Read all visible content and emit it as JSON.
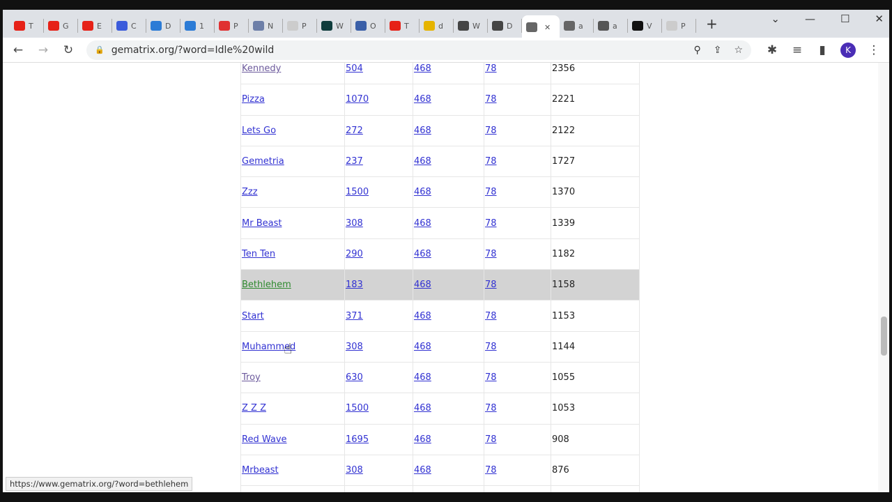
{
  "tabs": [
    {
      "label": "T",
      "color": "#e62117"
    },
    {
      "label": "G",
      "color": "#e62117"
    },
    {
      "label": "E",
      "color": "#e62117"
    },
    {
      "label": "C",
      "color": "#3b5bdb"
    },
    {
      "label": "D",
      "color": "#2b7bd6"
    },
    {
      "label": "1",
      "color": "#2b7bd6"
    },
    {
      "label": "P",
      "color": "#e03131"
    },
    {
      "label": "N",
      "color": "#6d7fa8"
    },
    {
      "label": "P",
      "color": "#cccccc"
    },
    {
      "label": "W",
      "color": "#0f3d3d"
    },
    {
      "label": "O",
      "color": "#3a5fa8"
    },
    {
      "label": "T",
      "color": "#e62117"
    },
    {
      "label": "d",
      "color": "#e6b400"
    },
    {
      "label": "W",
      "color": "#444444"
    },
    {
      "label": "D",
      "color": "#444444"
    },
    {
      "label": "",
      "color": "#666666",
      "active": true
    },
    {
      "label": "a",
      "color": "#666666"
    },
    {
      "label": "a",
      "color": "#555555"
    },
    {
      "label": "V",
      "color": "#111111"
    },
    {
      "label": "P",
      "color": "#cccccc"
    }
  ],
  "address": "gematrix.org/?word=Idle%20wild",
  "profile_initial": "K",
  "rows": [
    [
      "Kennedy",
      "504",
      "468",
      "78",
      "2356"
    ],
    [
      "Pizza",
      "1070",
      "468",
      "78",
      "2221"
    ],
    [
      "Lets Go",
      "272",
      "468",
      "78",
      "2122"
    ],
    [
      "Gemetria",
      "237",
      "468",
      "78",
      "1727"
    ],
    [
      "Zzz",
      "1500",
      "468",
      "78",
      "1370"
    ],
    [
      "Mr Beast",
      "308",
      "468",
      "78",
      "1339"
    ],
    [
      "Ten Ten",
      "290",
      "468",
      "78",
      "1182"
    ],
    [
      "Bethlehem",
      "183",
      "468",
      "78",
      "1158"
    ],
    [
      "Start",
      "371",
      "468",
      "78",
      "1153"
    ],
    [
      "Muhammed",
      "308",
      "468",
      "78",
      "1144"
    ],
    [
      "Troy",
      "630",
      "468",
      "78",
      "1055"
    ],
    [
      "Z Z Z",
      "1500",
      "468",
      "78",
      "1053"
    ],
    [
      "Red Wave",
      "1695",
      "468",
      "78",
      "908"
    ],
    [
      "Mrbeast",
      "308",
      "468",
      "78",
      "876"
    ],
    [
      "",
      "",
      "",
      "",
      ""
    ]
  ],
  "hovered_row": "Bethlehem",
  "status_url": "https://www.gematrix.org/?word=bethlehem"
}
